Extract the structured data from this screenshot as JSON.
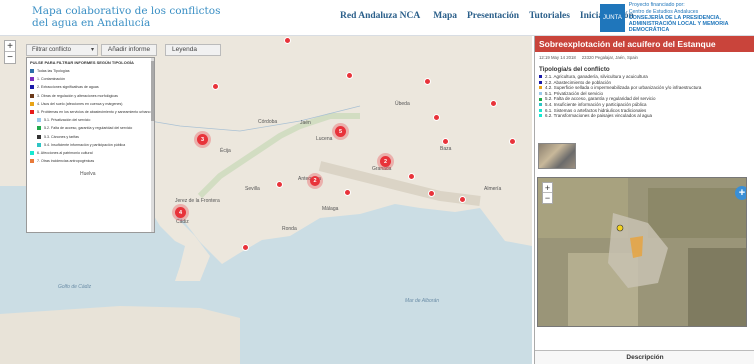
{
  "header": {
    "title_line1": "Mapa colaborativo de los conflictos",
    "title_line2": "del agua en Andalucía",
    "nav": [
      "Red Andaluza NCA",
      "Mapa",
      "Presentación",
      "Tutoriales",
      "Iniciar sesión"
    ],
    "badge_line1": "Proyecto financiado por:",
    "badge_line2": "Centro de Estudios Andaluces",
    "badge_line3": "CONSEJERÍA DE LA PRESIDENCIA,",
    "badge_line4": "ADMINISTRACIÓN LOCAL Y MEMORIA DEMOCRÁTICA",
    "junta_label": "JUNTA"
  },
  "toolbar": {
    "zoom_in": "+",
    "zoom_out": "−",
    "filter_label": "Filtrar conflicto",
    "add_label": "Añadir informe",
    "legend_label": "Leyenda"
  },
  "filter_panel": {
    "heading": "PULSE PARA FILTRAR INFORMES SEGÚN TIPOLOGÍA",
    "items": [
      {
        "label": "Todas las Tipologías",
        "color": "#2d6fa8",
        "sub": false
      },
      {
        "label": "1. Contaminación",
        "color": "#7b2fbe",
        "sub": false
      },
      {
        "label": "2. Extracciones significativas de aguas",
        "color": "#1a1aa8",
        "sub": false
      },
      {
        "label": "3. Obras de regulación y alteraciones morfológicas",
        "color": "#6b3a1a",
        "sub": false
      },
      {
        "label": "4. Usos del suelo (afecciones en cuenca y márgenes)",
        "color": "#e8a317",
        "sub": false
      },
      {
        "label": "5. Problemas en los servicios de abastecimiento y saneamiento urbano",
        "color": "#e81b1b",
        "sub": false
      },
      {
        "label": "5.1. Privatización del servicio",
        "color": "#9ac9ea",
        "sub": true
      },
      {
        "label": "5.2. Falta de acceso, garantía y regularidad del servicio",
        "color": "#1fa84a",
        "sub": true
      },
      {
        "label": "5.3. Cánones y tarifas",
        "color": "#333333",
        "sub": true
      },
      {
        "label": "5.4. Insuficiente información y participación pública",
        "color": "#2ec4c4",
        "sub": true
      },
      {
        "label": "6. Afecciones al patrimonio cultural",
        "color": "#17e8d0",
        "sub": false
      },
      {
        "label": "7. Otras incidencias antropogénicas",
        "color": "#e87a3a",
        "sub": false
      }
    ]
  },
  "map": {
    "clusters": [
      "3",
      "5",
      "2",
      "2",
      "4"
    ],
    "places": [
      "Jaén",
      "Córdoba",
      "Sevilla",
      "Granada",
      "Málaga",
      "Almería",
      "Cádiz",
      "Huelva",
      "Lucena",
      "Écija",
      "Úbeda",
      "Baza",
      "Antequera",
      "Ronda",
      "Jerez de la Frontera",
      "Mar de Alborán",
      "Golfo de Cádiz"
    ]
  },
  "report": {
    "title": "Sobreexplotación del acuífero del Estanque",
    "date": "12:19 May 14 2018",
    "location": "23320 Pegalajar, Jaén, Spain",
    "section": "Tipología/s del conflicto",
    "conflicts": [
      {
        "label": "2.1. Agricultura, ganadería, silvicultura y acuicultura",
        "color": "#1a1aa8"
      },
      {
        "label": "2.2. Abastecimiento de población",
        "color": "#1a1aa8"
      },
      {
        "label": "4.2. Superficie sellada o impermeabilizada por urbanización y/o infraestructura",
        "color": "#e8a317"
      },
      {
        "label": "5.1. Privatización del servicio",
        "color": "#9ac9ea"
      },
      {
        "label": "5.2. Falta de acceso, garantía y regularidad del servicio",
        "color": "#1fa84a"
      },
      {
        "label": "5.4. Insuficiente información y participación pública",
        "color": "#2ec4c4"
      },
      {
        "label": "6.1. Sistemas o artefactos hidráulicos tradicionales",
        "color": "#17e8d0"
      },
      {
        "label": "6.2. Transformaciones de paisajes vinculados al agua",
        "color": "#17e8d0"
      }
    ],
    "description_tab": "Descripción"
  }
}
